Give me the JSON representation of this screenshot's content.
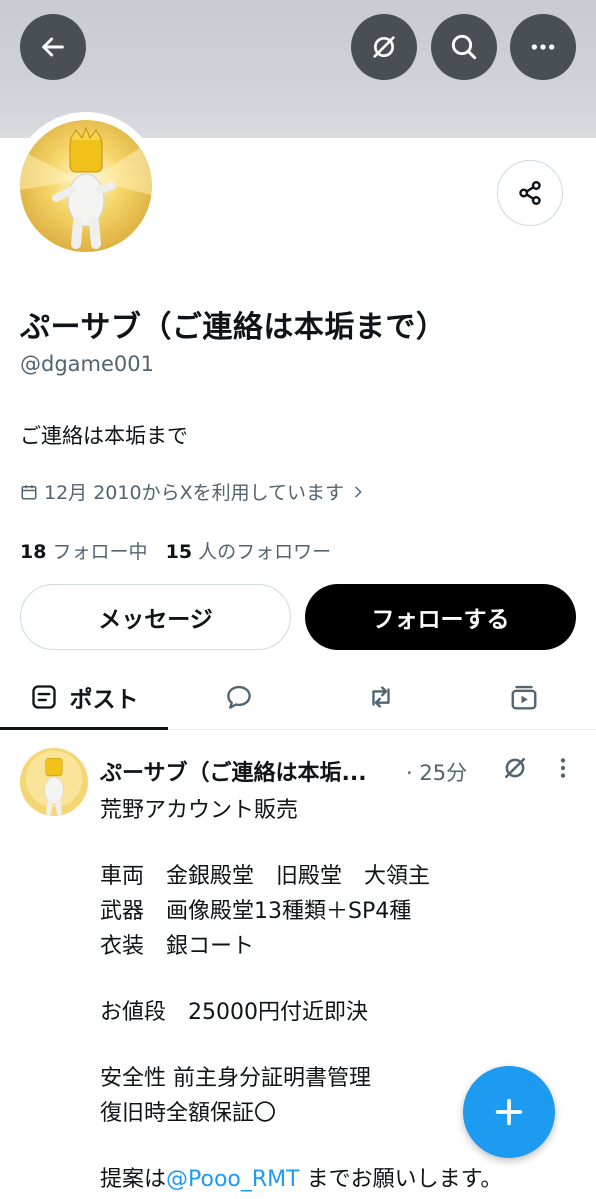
{
  "header": {
    "back_icon": "arrow-left-icon",
    "grok_icon": "grok-icon",
    "search_icon": "search-icon",
    "more_icon": "more-horizontal-icon"
  },
  "profile": {
    "display_name": "ぷーサブ（ご連絡は本垢まで）",
    "handle": "@dgame001",
    "bio": "ご連絡は本垢まで",
    "joined": "12月 2010からXを利用しています",
    "following_count": "18",
    "following_label": "フォロー中",
    "followers_count": "15",
    "followers_label": "人のフォロワー"
  },
  "actions": {
    "message_label": "メッセージ",
    "follow_label": "フォローする"
  },
  "tabs": [
    {
      "label": "ポスト",
      "icon": "posts-icon",
      "active": true
    },
    {
      "label": "",
      "icon": "replies-icon"
    },
    {
      "label": "",
      "icon": "reposts-icon"
    },
    {
      "label": "",
      "icon": "media-icon"
    }
  ],
  "post": {
    "author": "ぷーサブ（ご連絡は本垢...",
    "time": "· 25分",
    "lines": [
      "荒野アカウント販売",
      "",
      "車両　金銀殿堂　旧殿堂　大領主",
      "武器　画像殿堂13種類＋SP4種",
      "衣装　銀コート",
      "",
      "お値段　25000円付近即決",
      "",
      "安全性 前主身分証明書管理",
      "復旧時全額保証〇",
      ""
    ],
    "last_prefix": "提案は",
    "last_mention": "@Pooo_RMT",
    "last_suffix": " までお願いします。"
  },
  "colors": {
    "accent": "#1d9bf0",
    "text": "#0f1419",
    "secondary": "#536471",
    "banner": "#cfd3d7"
  }
}
